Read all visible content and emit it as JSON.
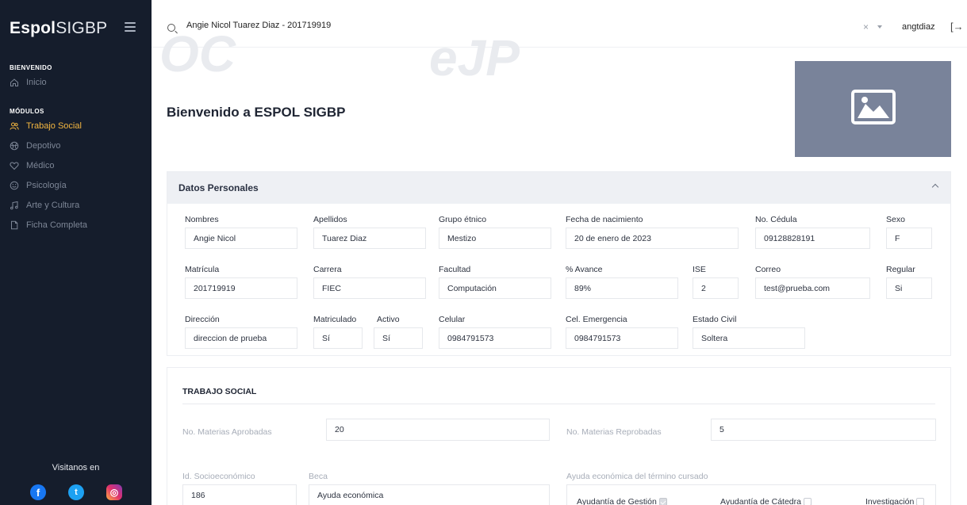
{
  "brand": {
    "bold": "Espol",
    "light": "SIGBP"
  },
  "sidebar": {
    "sections": [
      {
        "title": "BIENVENIDO"
      },
      {
        "title": "MÓDULOS"
      }
    ],
    "items": [
      {
        "label": "Inicio",
        "icon": "home-icon",
        "active": false
      },
      {
        "label": "Trabajo Social",
        "icon": "users-icon",
        "active": true
      },
      {
        "label": "Depotivo",
        "icon": "ball-icon",
        "active": false
      },
      {
        "label": "Médico",
        "icon": "heart-icon",
        "active": false
      },
      {
        "label": "Psicología",
        "icon": "smile-icon",
        "active": false
      },
      {
        "label": "Arte y Cultura",
        "icon": "music-icon",
        "active": false
      },
      {
        "label": "Ficha Completa",
        "icon": "file-icon",
        "active": false
      }
    ],
    "visit_label": "Visitanos en",
    "social": [
      {
        "name": "facebook-icon",
        "glyph": "f",
        "color": "#1877f2"
      },
      {
        "name": "twitter-icon",
        "glyph": "t",
        "color": "#1da1f2"
      },
      {
        "name": "instagram-icon",
        "glyph": "◎",
        "color": "#d6249f"
      }
    ]
  },
  "header": {
    "search_value": "Angie Nicol Tuarez Diaz - 201719919",
    "clear_glyph": "×",
    "username": "angtdiaz",
    "logout_glyph": "[→"
  },
  "main": {
    "title": "Bienvenido a ESPOL SIGBP",
    "personal": {
      "header": "Datos Personales",
      "nombres": {
        "label": "Nombres",
        "value": "Angie Nicol"
      },
      "apellidos": {
        "label": "Apellidos",
        "value": "Tuarez Diaz"
      },
      "grupo": {
        "label": "Grupo étnico",
        "value": "Mestizo"
      },
      "nacimiento": {
        "label": "Fecha de nacimiento",
        "value": "20 de enero de 2023"
      },
      "cedula": {
        "label": "No. Cédula",
        "value": "09128828191"
      },
      "sexo": {
        "label": "Sexo",
        "value": "F"
      },
      "matricula": {
        "label": "Matrícula",
        "value": "201719919"
      },
      "carrera": {
        "label": "Carrera",
        "value": "FIEC"
      },
      "facultad": {
        "label": "Facultad",
        "value": "Computación"
      },
      "avance": {
        "label": "% Avance",
        "value": "89%"
      },
      "ise": {
        "label": "ISE",
        "value": "2"
      },
      "correo": {
        "label": "Correo",
        "value": "test@prueba.com"
      },
      "regular": {
        "label": "Regular",
        "value": "Si"
      },
      "direccion": {
        "label": "Dirección",
        "value": "direccion de prueba"
      },
      "matriculado": {
        "label": "Matriculado",
        "value": "Sí"
      },
      "activo": {
        "label": "Activo",
        "value": "Sí"
      },
      "celular": {
        "label": "Celular",
        "value": "0984791573"
      },
      "emergencia": {
        "label": "Cel. Emergencia",
        "value": "0984791573"
      },
      "estado_civil": {
        "label": "Estado Civil",
        "value": "Soltera"
      }
    },
    "social_work": {
      "title": "TRABAJO SOCIAL",
      "aprobadas": {
        "label": "No. Materias Aprobadas",
        "value": "20"
      },
      "reprobadas": {
        "label": "No. Materias Reprobadas",
        "value": "5"
      },
      "socioeconomico": {
        "label": "Id. Socioeconómico",
        "value": "186"
      },
      "beca": {
        "label": "Beca",
        "value": "Ayuda económica"
      },
      "ayuda": {
        "label": "Ayuda económica del término cursado",
        "options": [
          {
            "label": "Ayudantía de Gestión",
            "checked": true
          },
          {
            "label": "Ayudantía de Cátedra",
            "checked": false
          },
          {
            "label": "Investigación",
            "checked": false
          }
        ]
      }
    }
  }
}
